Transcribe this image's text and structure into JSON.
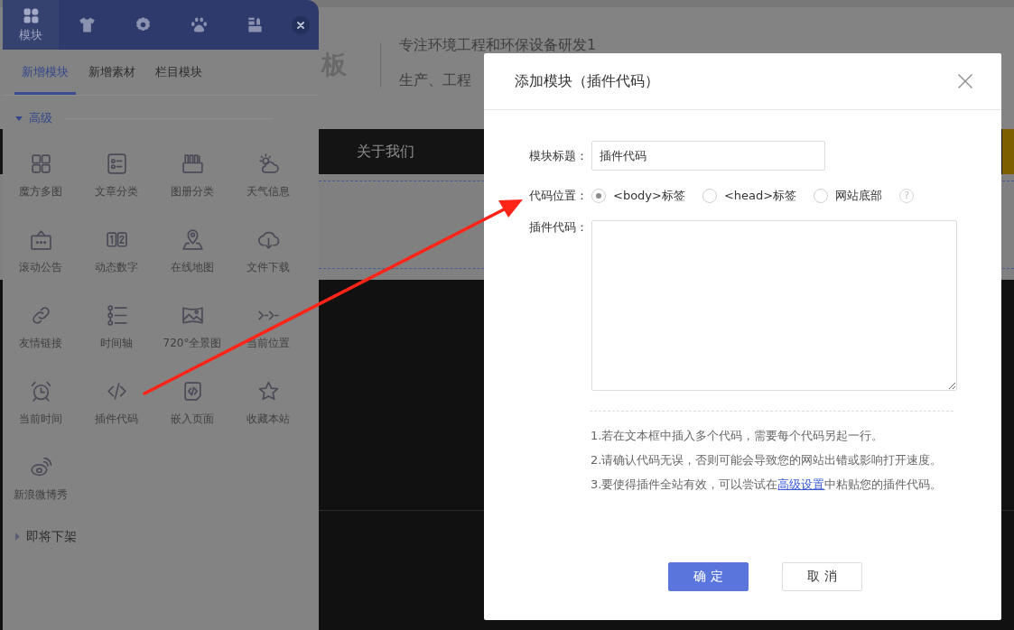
{
  "background_page": {
    "logo_text": "板",
    "slogan_lines": [
      "专注环境工程和环保设备研发1",
      "生产、工程"
    ],
    "nav_items": [
      "关于我们"
    ]
  },
  "module_panel": {
    "header_tabs": [
      {
        "kind": "grid",
        "label": "模块",
        "selected": true
      },
      {
        "kind": "shirt",
        "selected": false
      },
      {
        "kind": "gear",
        "selected": false
      },
      {
        "kind": "paw",
        "selected": false
      },
      {
        "kind": "stack",
        "selected": false
      }
    ],
    "sub_tabs": [
      {
        "label": "新增模块",
        "selected": true
      },
      {
        "label": "新增素材",
        "selected": false
      },
      {
        "label": "栏目模块",
        "selected": false
      }
    ],
    "sections": [
      {
        "title": "高级",
        "expanded": true,
        "items": [
          {
            "kind": "cube-grid",
            "label": "魔方多图"
          },
          {
            "kind": "article",
            "label": "文章分类"
          },
          {
            "kind": "album",
            "label": "图册分类"
          },
          {
            "kind": "weather",
            "label": "天气信息"
          },
          {
            "kind": "notice",
            "label": "滚动公告"
          },
          {
            "kind": "counter",
            "label": "动态数字"
          },
          {
            "kind": "map",
            "label": "在线地图"
          },
          {
            "kind": "download",
            "label": "文件下载"
          },
          {
            "kind": "link",
            "label": "友情链接"
          },
          {
            "kind": "timeline",
            "label": "时间轴"
          },
          {
            "kind": "panorama",
            "label": "720°全景图"
          },
          {
            "kind": "breadcrumb",
            "label": "当前位置"
          },
          {
            "kind": "clock",
            "label": "当前时间"
          },
          {
            "kind": "code",
            "label": "插件代码"
          },
          {
            "kind": "embed",
            "label": "嵌入页面"
          },
          {
            "kind": "favorite",
            "label": "收藏本站"
          },
          {
            "kind": "social",
            "label": "新浪微博秀"
          }
        ]
      },
      {
        "title": "即将下架",
        "expanded": false
      }
    ]
  },
  "dialog": {
    "title": "添加模块（插件代码）",
    "fields": [
      {
        "kind": "text",
        "label": "模块标题：",
        "value": "插件代码"
      },
      {
        "kind": "radio",
        "label": "代码位置：",
        "options": [
          {
            "label": "<body>标签",
            "selected": true
          },
          {
            "label": "<head>标签",
            "selected": false
          },
          {
            "label": "网站底部",
            "selected": false
          }
        ],
        "help": "?"
      },
      {
        "kind": "textarea",
        "label": "插件代码："
      }
    ],
    "notes": [
      {
        "text": "1.若在文本框中插入多个代码，需要每个代码另起一行。"
      },
      {
        "text": "2.请确认代码无误，否则可能会导致您的网站出错或影响打开速度。"
      },
      {
        "text": "3.要使得插件全站有效，可以尝试在",
        "link": "高级设置",
        "text_after": "中粘贴您的插件代码。"
      }
    ],
    "buttons": [
      {
        "kind": "primary",
        "label": "确 定"
      },
      {
        "kind": "secondary",
        "label": "取 消"
      }
    ]
  }
}
